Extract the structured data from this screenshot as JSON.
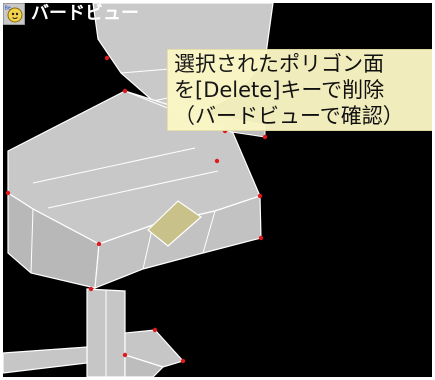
{
  "viewport": {
    "title": "バードビュー",
    "icon": "bird-view-icon",
    "background": "#000000"
  },
  "callout": {
    "lines": [
      "選択されたポリゴン面",
      "を[Delete]キーで削除",
      "（バードビューで確認）"
    ],
    "background": "#fbf6c3"
  },
  "model": {
    "face_color": "#c8c8c8",
    "edge_color": "#ffffff",
    "vertex_color": "#e01a1a",
    "selected_polygon_color": "#c8c28a"
  }
}
